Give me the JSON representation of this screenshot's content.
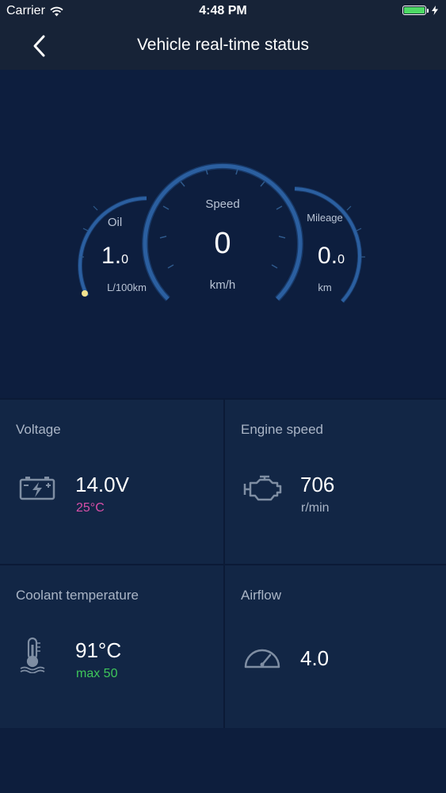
{
  "status_bar": {
    "carrier": "Carrier",
    "time": "4:48 PM",
    "battery_level": 1.0,
    "icons": [
      "wifi-icon",
      "battery-icon",
      "charging-icon"
    ]
  },
  "nav": {
    "title": "Vehicle real-time status",
    "back_icon": "chevron-left-icon"
  },
  "gauges": {
    "oil": {
      "label": "Oil",
      "value_int": "1.",
      "value_dec": "0",
      "unit": "L/100km"
    },
    "speed": {
      "label": "Speed",
      "value": "0",
      "unit": "km/h"
    },
    "mileage": {
      "label": "Mileage",
      "value_int": "0.",
      "value_dec": "0",
      "unit": "km"
    }
  },
  "tiles": {
    "voltage": {
      "title": "Voltage",
      "value": "14.0V",
      "sub": "25°C",
      "icon": "battery-icon"
    },
    "engine_speed": {
      "title": "Engine speed",
      "value": "706",
      "sub": "r/min",
      "icon": "engine-icon"
    },
    "coolant": {
      "title": "Coolant temperature",
      "value": "91°C",
      "sub": "max 50",
      "icon": "thermometer-icon"
    },
    "airflow": {
      "title": "Airflow",
      "value": "4.0",
      "icon": "speedometer-icon"
    }
  },
  "colors": {
    "background": "#0b1a36",
    "gauge_arc": "#2b5fa0",
    "voltage_sub": "#d84fa8",
    "coolant_sub": "#3ec65a",
    "oil_indicator": "#f3e38f"
  }
}
